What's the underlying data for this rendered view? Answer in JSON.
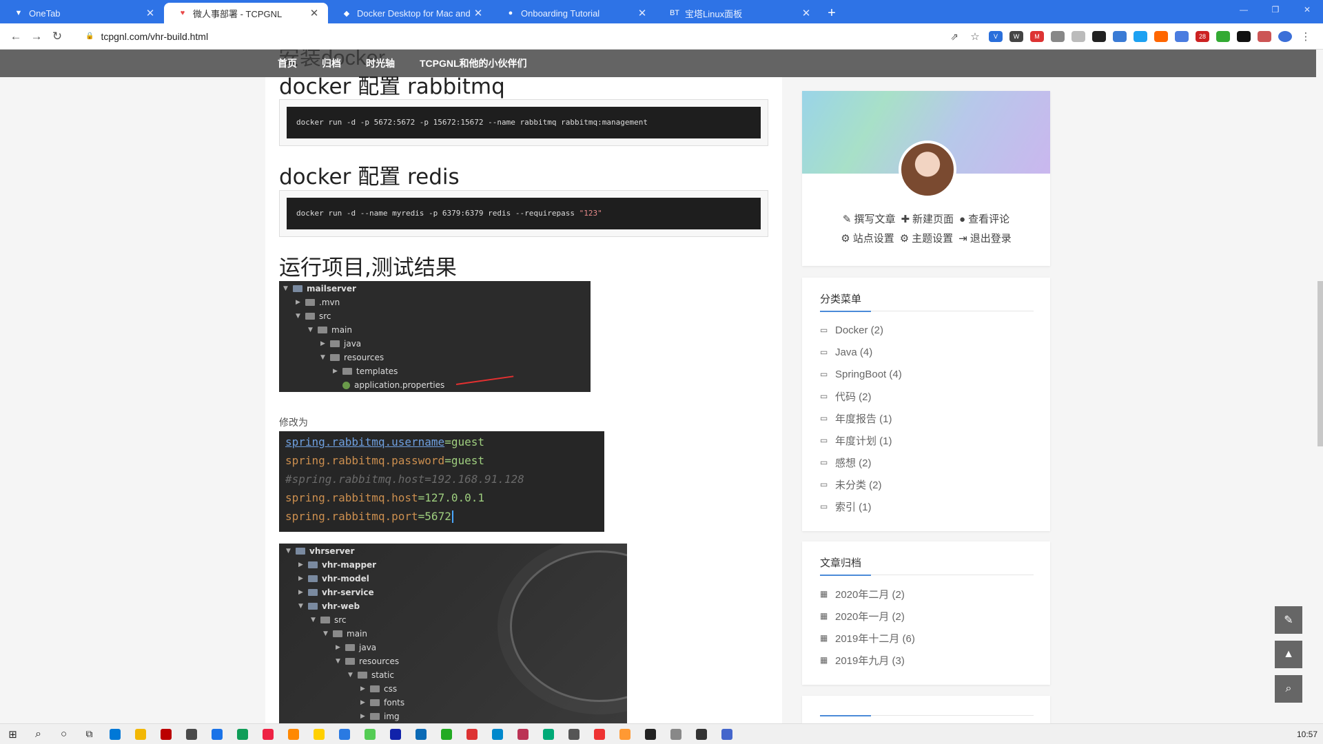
{
  "browser": {
    "tabs": [
      {
        "title": "OneTab",
        "icon": "onetab-icon",
        "glyph": "▼"
      },
      {
        "title": "微人事部署 - TCPGNL",
        "icon": "site-favicon-icon",
        "glyph": "♥"
      },
      {
        "title": "Docker Desktop for Mac and W",
        "icon": "docker-icon",
        "glyph": "◆"
      },
      {
        "title": "Onboarding Tutorial",
        "icon": "github-icon",
        "glyph": "●"
      },
      {
        "title": "宝塔Linux面板",
        "icon": "bt-panel-icon",
        "glyph": "BT"
      }
    ],
    "active_tab": 1,
    "url": "tcpgnl.com/vhr-build.html"
  },
  "site_nav": {
    "ghost_heading": "安装docker",
    "items": [
      "首页",
      "归档",
      "时光轴",
      "TCPGNL和他的小伙伴们"
    ]
  },
  "article": {
    "h_rabbitmq": "docker 配置 rabbitmq",
    "code_rabbitmq": "docker run -d -p 5672:5672 -p 15672:15672 --name rabbitmq rabbitmq:management",
    "h_redis": "docker 配置 redis",
    "code_redis_cmd": "docker run -d --name myredis -p 6379:6379 redis --requirepass ",
    "code_redis_str": "\"123\"",
    "h_run": "运行项目,测试结果",
    "tree1": [
      {
        "label": "mailserver",
        "depth": 0,
        "arrow": "▼",
        "kind": "mod",
        "bold": true
      },
      {
        "label": ".mvn",
        "depth": 1,
        "arrow": "▶",
        "kind": "folder"
      },
      {
        "label": "src",
        "depth": 1,
        "arrow": "▼",
        "kind": "folder"
      },
      {
        "label": "main",
        "depth": 2,
        "arrow": "▼",
        "kind": "folder"
      },
      {
        "label": "java",
        "depth": 3,
        "arrow": "▶",
        "kind": "folder"
      },
      {
        "label": "resources",
        "depth": 3,
        "arrow": "▼",
        "kind": "folder"
      },
      {
        "label": "templates",
        "depth": 4,
        "arrow": "▶",
        "kind": "folder"
      },
      {
        "label": "application.properties",
        "depth": 4,
        "arrow": "",
        "kind": "leaf"
      }
    ],
    "caption": "修改为",
    "props": {
      "k1": "spring.rabbitmq.username",
      "v1": "guest",
      "k2": "spring.rabbitmq.password",
      "v2": "guest",
      "comment": "#spring.rabbitmq.host=192.168.91.128",
      "k4": "spring.rabbitmq.host",
      "v4": "127.0.0.1",
      "k5": "spring.rabbitmq.port",
      "v5": "5672",
      "eq": "="
    },
    "tree2": [
      {
        "label": "vhrserver",
        "depth": 0,
        "arrow": "▼",
        "kind": "mod",
        "bold": true
      },
      {
        "label": "vhr-mapper",
        "depth": 1,
        "arrow": "▶",
        "kind": "mod",
        "bold": true
      },
      {
        "label": "vhr-model",
        "depth": 1,
        "arrow": "▶",
        "kind": "mod",
        "bold": true
      },
      {
        "label": "vhr-service",
        "depth": 1,
        "arrow": "▶",
        "kind": "mod",
        "bold": true
      },
      {
        "label": "vhr-web",
        "depth": 1,
        "arrow": "▼",
        "kind": "mod",
        "bold": true
      },
      {
        "label": "src",
        "depth": 2,
        "arrow": "▼",
        "kind": "folder"
      },
      {
        "label": "main",
        "depth": 3,
        "arrow": "▼",
        "kind": "folder"
      },
      {
        "label": "java",
        "depth": 4,
        "arrow": "▶",
        "kind": "folder"
      },
      {
        "label": "resources",
        "depth": 4,
        "arrow": "▼",
        "kind": "folder"
      },
      {
        "label": "static",
        "depth": 5,
        "arrow": "▼",
        "kind": "folder"
      },
      {
        "label": "css",
        "depth": 6,
        "arrow": "▶",
        "kind": "folder"
      },
      {
        "label": "fonts",
        "depth": 6,
        "arrow": "▶",
        "kind": "folder"
      },
      {
        "label": "img",
        "depth": 6,
        "arrow": "▶",
        "kind": "folder"
      }
    ]
  },
  "profile": {
    "links_row1": [
      {
        "icon": "pencil-icon",
        "glyph": "✎",
        "label": "撰写文章"
      },
      {
        "icon": "plus-icon",
        "glyph": "✚",
        "label": "新建页面"
      },
      {
        "icon": "comments-icon",
        "glyph": "●",
        "label": "查看评论"
      }
    ],
    "links_row2": [
      {
        "icon": "cogs-icon",
        "glyph": "⚙",
        "label": "站点设置"
      },
      {
        "icon": "cog-icon",
        "glyph": "⚙",
        "label": "主题设置"
      },
      {
        "icon": "sign-out-icon",
        "glyph": "⇥",
        "label": "退出登录"
      }
    ]
  },
  "categories": {
    "title": "分类菜单",
    "items": [
      "Docker (2)",
      "Java (4)",
      "SpringBoot (4)",
      "代码 (2)",
      "年度报告 (1)",
      "年度计划 (1)",
      "感想 (2)",
      "未分类 (2)",
      "索引 (1)"
    ]
  },
  "archives": {
    "title": "文章归档",
    "items": [
      "2020年二月 (2)",
      "2020年一月 (2)",
      "2019年十二月 (6)",
      "2019年九月 (3)"
    ]
  },
  "taskbar": {
    "time": "10:57",
    "apps": [
      "#0078d7",
      "#f2b705",
      "#b00",
      "#4a4a4a",
      "#1a73e8",
      "#0f9d58",
      "#e24",
      "#f80",
      "#ffd000",
      "#2a7ae2",
      "#5c5",
      "#12a",
      "#0b6ab5",
      "#2a2",
      "#d33",
      "#08c",
      "#b35",
      "#0a7",
      "#555",
      "#e33",
      "#f93",
      "#222",
      "#888",
      "#333",
      "#46c"
    ]
  }
}
